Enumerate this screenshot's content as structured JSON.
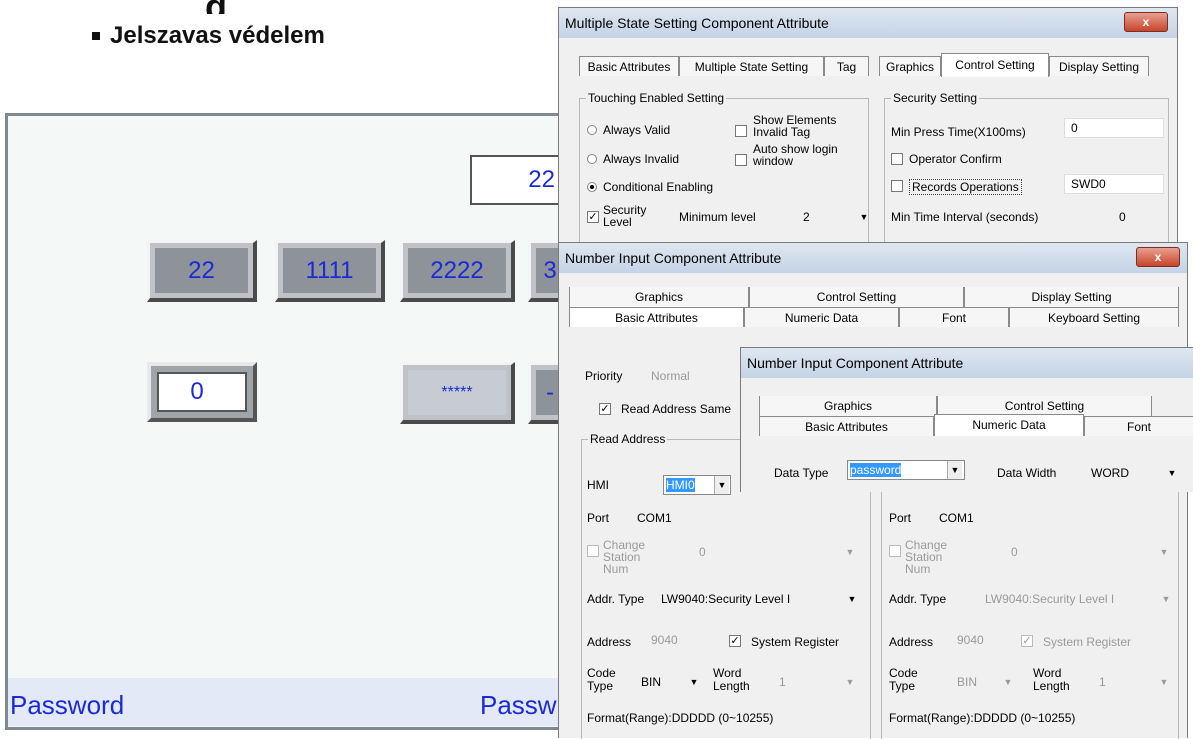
{
  "slide": {
    "bullet": "Jelszavas védelem"
  },
  "hmi": {
    "top_value": "22",
    "buttons": [
      "22",
      "1111",
      "2222"
    ],
    "field_value": "0",
    "masked_value": "*****",
    "footer_left": "Password",
    "footer_right": "Passw"
  },
  "dlg1": {
    "title": "Multiple State Setting Component Attribute",
    "close": "x",
    "tabs": [
      "Basic Attributes",
      "Multiple State Setting",
      "Tag",
      "Graphics",
      "Control Setting",
      "Display Setting"
    ],
    "touch_group": "Touching Enabled Setting",
    "always_valid": "Always Valid",
    "always_invalid": "Always Invalid",
    "conditional": "Conditional Enabling",
    "security_level": "Security Level",
    "min_level_label": "Minimum level",
    "min_level_value": "2",
    "show_elements": "Show Elements Invalid Tag",
    "auto_show": "Auto show login window",
    "security_group": "Security Setting",
    "min_press": "Min Press Time(X100ms)",
    "min_press_value": "0",
    "operator_confirm": "Operator Confirm",
    "records_ops": "Records Operations",
    "records_value": "SWD0",
    "min_interval": "Min Time Interval (seconds)",
    "min_interval_value": "0"
  },
  "dlg2": {
    "title": "Number Input Component Attribute",
    "close": "x",
    "tabs_top": [
      "Graphics",
      "Control Setting",
      "Display Setting"
    ],
    "tabs_bottom": [
      "Basic Attributes",
      "Numeric Data",
      "Font",
      "Keyboard Setting"
    ],
    "priority_label": "Priority",
    "priority_value": "Normal",
    "read_same": "Read Address Same",
    "read_group": "Read Address",
    "hmi_label": "HMI",
    "hmi_value": "HMI0",
    "port_label": "Port",
    "port_value": "COM1",
    "change_station": "Change Station Num",
    "station_value": "0",
    "addr_type_label": "Addr. Type",
    "addr_type_value": "LW9040:Security Level I",
    "address_label": "Address",
    "address_value": "9040",
    "system_register": "System Register",
    "code_type_label": "Code Type",
    "code_type_value": "BIN",
    "word_length_label": "Word Length",
    "word_length_value": "1",
    "format": "Format(Range):DDDDD (0~10255)"
  },
  "dlg3": {
    "title": "Number Input Component Attribute",
    "tabs_top": [
      "Graphics",
      "Control Setting"
    ],
    "tabs_bottom": [
      "Basic Attributes",
      "Numeric Data",
      "Font"
    ],
    "data_type_label": "Data Type",
    "data_type_value": "password",
    "data_width_label": "Data Width",
    "data_width_value": "WORD",
    "port_label": "Port",
    "port_value": "COM1",
    "change_station": "Change Station Num",
    "station_value": "0",
    "addr_type_label": "Addr. Type",
    "addr_type_value": "LW9040:Security Level I",
    "address_label": "Address",
    "address_value": "9040",
    "system_register": "System Register",
    "code_type_label": "Code Type",
    "code_type_value": "BIN",
    "word_length_label": "Word Length",
    "word_length_value": "1",
    "format": "Format(Range):DDDDD (0~10255)"
  }
}
